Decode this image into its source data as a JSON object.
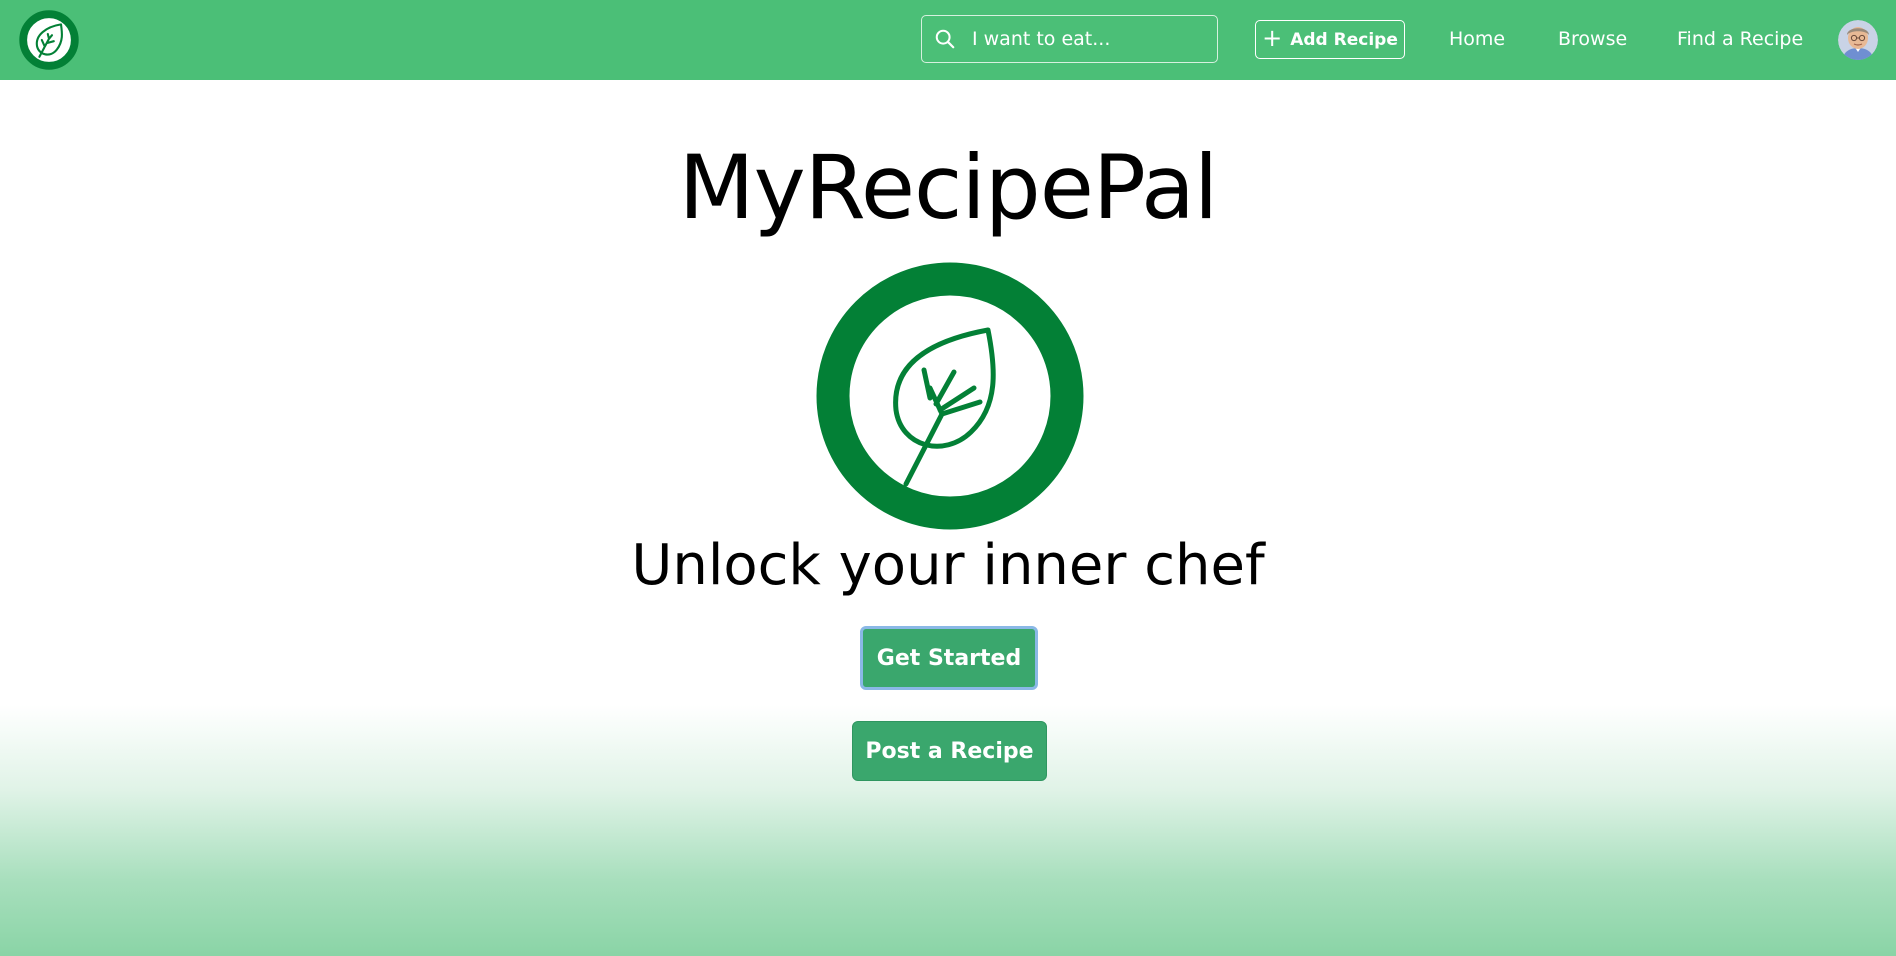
{
  "navbar": {
    "logo_icon": "leaf-icon",
    "search": {
      "placeholder": "I want to eat...",
      "value": "",
      "icon": "search-icon"
    },
    "add_recipe": {
      "icon": "plus-icon",
      "label": "Add Recipe"
    },
    "links": {
      "home": "Home",
      "browse": "Browse",
      "find": "Find a Recipe"
    },
    "avatar_icon": "avatar"
  },
  "hero": {
    "title": "MyRecipePal",
    "logo_icon": "leaf-icon",
    "tagline": "Unlock your inner chef",
    "get_started": "Get Started",
    "post_recipe": "Post a Recipe"
  },
  "colors": {
    "navbar": "#4bbf77",
    "logo_green": "#038036",
    "button_green": "#3aa76d",
    "focus_ring": "#8ab8e6"
  }
}
